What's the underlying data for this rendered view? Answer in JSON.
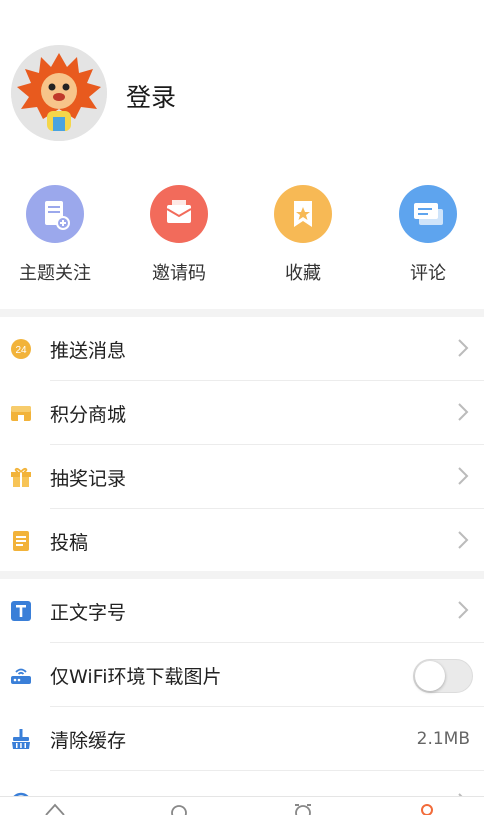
{
  "profile": {
    "login_label": "登录"
  },
  "quick_actions": [
    {
      "label": "主题关注",
      "icon": "doc-add-icon",
      "color": "#9ba8ec"
    },
    {
      "label": "邀请码",
      "icon": "mail-icon",
      "color": "#f26b5b"
    },
    {
      "label": "收藏",
      "icon": "bookmark-icon",
      "color": "#f7b955"
    },
    {
      "label": "评论",
      "icon": "chat-icon",
      "color": "#5ea4ee"
    }
  ],
  "menu_group1": [
    {
      "label": "推送消息",
      "icon": "push-24-icon",
      "color": "#f2b33a"
    },
    {
      "label": "积分商城",
      "icon": "store-icon",
      "color": "#f2b33a"
    },
    {
      "label": "抽奖记录",
      "icon": "gift-icon",
      "color": "#f2b33a"
    },
    {
      "label": "投稿",
      "icon": "submit-doc-icon",
      "color": "#f2b33a"
    }
  ],
  "menu_group2": [
    {
      "label": "正文字号",
      "icon": "font-size-icon",
      "color": "#3a7fd8"
    },
    {
      "label": "仅WiFi环境下载图片",
      "icon": "router-icon",
      "color": "#3a7fd8",
      "toggle_on": false
    },
    {
      "label": "清除缓存",
      "icon": "broom-icon",
      "color": "#3a7fd8",
      "value": "2.1MB"
    }
  ],
  "tab_bar": {
    "active_color": "#f26b3a"
  }
}
